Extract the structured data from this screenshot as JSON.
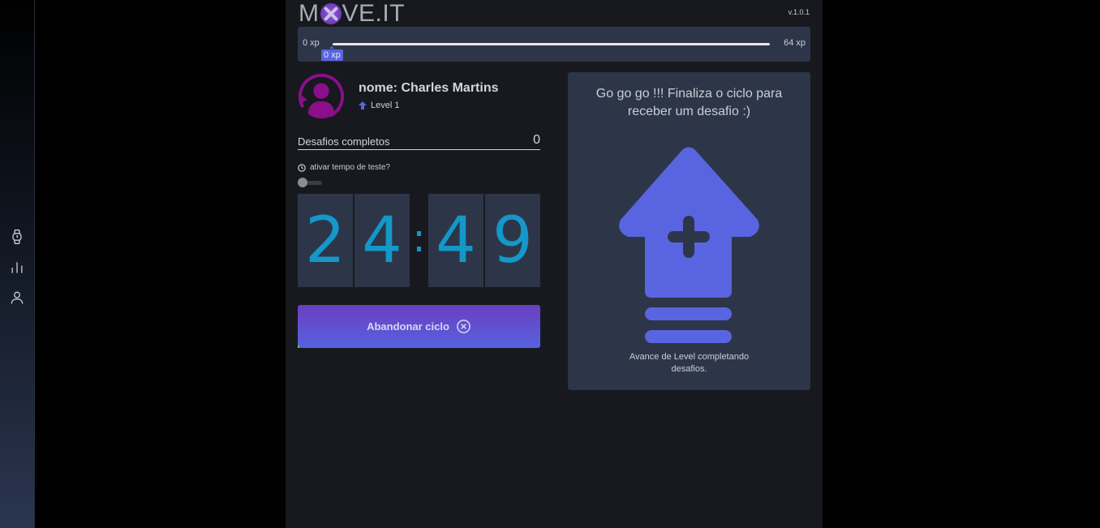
{
  "sidebar": {
    "items": [
      {
        "icon": "watch-icon"
      },
      {
        "icon": "bar-chart-icon"
      },
      {
        "icon": "user-icon"
      }
    ]
  },
  "header": {
    "logo_left": "M",
    "logo_right": "VE.IT",
    "version": "v.1.0.1"
  },
  "xp": {
    "min_label": "0 xp",
    "max_label": "64 xp",
    "current_label": "0 xp",
    "progress": 0
  },
  "profile": {
    "name": "nome: Charles Martins",
    "level": "Level 1"
  },
  "completed": {
    "label": "Desafios completos",
    "value": "0"
  },
  "test_mode": {
    "label": "ativar tempo de teste?"
  },
  "timer": {
    "minutes": [
      "2",
      "4"
    ],
    "separator": ":",
    "seconds": [
      "4",
      "9"
    ]
  },
  "abandon_button": {
    "label": "Abandonar ciclo"
  },
  "challenge": {
    "title": "Go go go !!! Finaliza o ciclo para receber um desafio :)",
    "description": "Avance de Level completando desafios."
  },
  "colors": {
    "accent": "#5965e0",
    "timer_digit": "#1497c9",
    "panel": "#2d3648",
    "background": "#18191f"
  }
}
